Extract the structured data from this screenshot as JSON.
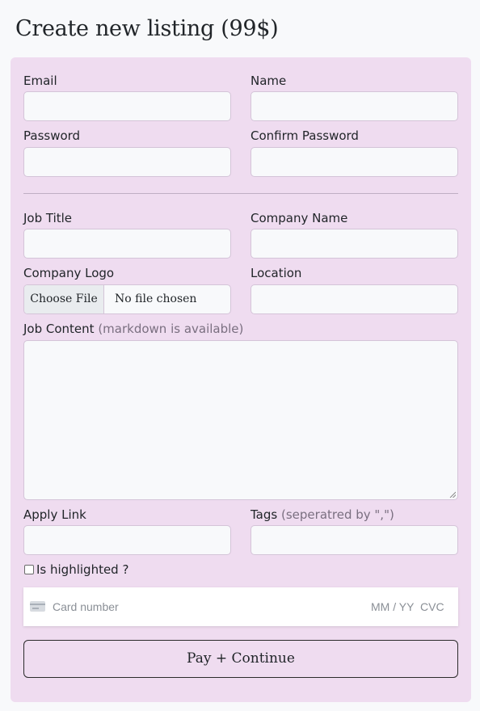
{
  "page": {
    "title": "Create new listing (99$)"
  },
  "form": {
    "email_label": "Email",
    "name_label": "Name",
    "password_label": "Password",
    "confirm_password_label": "Confirm Password",
    "job_title_label": "Job Title",
    "company_name_label": "Company Name",
    "company_logo_label": "Company Logo",
    "file_button": "Choose File",
    "file_status": "No file chosen",
    "location_label": "Location",
    "job_content_label": "Job Content",
    "job_content_hint": "(markdown is available)",
    "apply_link_label": "Apply Link",
    "tags_label": "Tags",
    "tags_hint": "(seperatred by \",\")",
    "highlighted_label": "Is highlighted ?",
    "card_number_placeholder": "Card number",
    "card_expiry_placeholder": "MM / YY",
    "card_cvc_placeholder": "CVC",
    "submit_label": "Pay + Continue"
  },
  "icons": {
    "card": "credit-card-icon"
  },
  "colors": {
    "panel": "#efdcf0",
    "page": "#f8f9fb"
  }
}
